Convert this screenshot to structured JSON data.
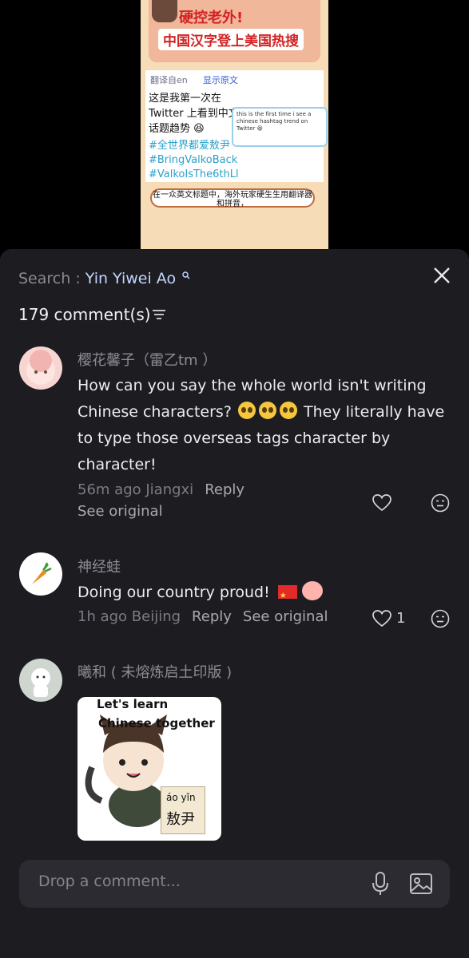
{
  "video": {
    "headline1": "硬控老外!",
    "headline2": "中国汉字登上美国热搜",
    "translate_from": "翻译自en",
    "show_original": "显示原文",
    "body": "这是我第一次在 Twitter 上看到中文话题趋势 😆",
    "tags": "#全世界都爱敖尹 #BringValkoBack #ValkoIsThe6thLl",
    "inset_text": "this is the first time i see a chinese hashtag trend on Twitter 😆",
    "subtitle": "在一众英文标题中，海外玩家硬生生用翻译器和拼音，"
  },
  "header": {
    "search_prefix": "Search : ",
    "search_query": "Yin Yiwei Ao",
    "count": "179 comment(s)"
  },
  "comments": [
    {
      "name": "樱花馨子（雷乙tm ）",
      "text_a": "How can you say the whole world isn't writing Chinese characters?",
      "text_b": "They literally have to type those overseas tags character by character!",
      "meta": "56m ago Jiangxi",
      "reply": "Reply",
      "see_original": "See original"
    },
    {
      "name": "神经蛙",
      "text": "Doing our country proud!",
      "meta": "1h ago Beijing",
      "reply": "Reply",
      "see_original": "See original",
      "likes": "1"
    },
    {
      "name": "曦和 ( 未熔炼启土印版 )",
      "sticker_line1": "Let's learn",
      "sticker_line2": "Chinese together",
      "sticker_pinyin": "áo yǐn",
      "sticker_hanzi": "敖尹"
    }
  ],
  "input": {
    "placeholder": "Drop a comment..."
  },
  "colors": {
    "sheet_bg": "#1c1c21",
    "accent_query": "#c4d6ff",
    "input_bg": "#2b2b31"
  },
  "icons": [
    "search-icon",
    "close-icon",
    "sort-icon",
    "heart-icon",
    "dislike-face-icon",
    "mic-icon",
    "image-icon"
  ]
}
